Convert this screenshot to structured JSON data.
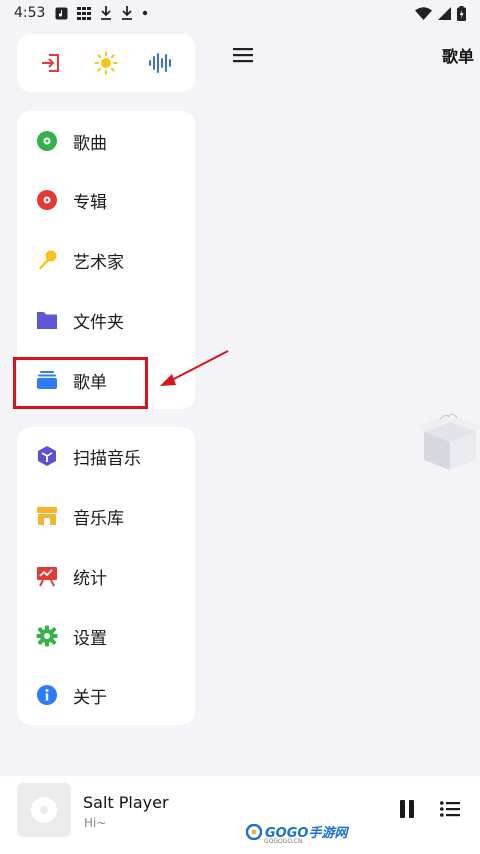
{
  "status_bar": {
    "time": "4:53"
  },
  "header": {
    "title": "歌单"
  },
  "quick_actions": [
    {
      "icon": "exit-icon",
      "color": "#e53935"
    },
    {
      "icon": "sun-icon",
      "color": "#f5c518"
    },
    {
      "icon": "equalizer-icon",
      "color": "#3b6fe0"
    }
  ],
  "nav_primary": [
    {
      "label": "歌曲",
      "icon": "song-disc-icon",
      "color": "#35b24a"
    },
    {
      "label": "专辑",
      "icon": "album-disc-icon",
      "color": "#e53935"
    },
    {
      "label": "艺术家",
      "icon": "microphone-icon",
      "color": "#f5c518"
    },
    {
      "label": "文件夹",
      "icon": "folder-icon",
      "color": "#5f57d8"
    },
    {
      "label": "歌单",
      "icon": "playlist-icon",
      "color": "#2f7cf6"
    }
  ],
  "nav_secondary": [
    {
      "label": "扫描音乐",
      "icon": "scan-icon",
      "color": "#5f4fd6"
    },
    {
      "label": "音乐库",
      "icon": "store-icon",
      "color": "#f5b52a"
    },
    {
      "label": "统计",
      "icon": "stats-icon",
      "color": "#e53935"
    },
    {
      "label": "设置",
      "icon": "gear-icon",
      "color": "#35b24a"
    },
    {
      "label": "关于",
      "icon": "info-icon",
      "color": "#2f7cf6"
    }
  ],
  "player": {
    "title": "Salt Player",
    "subtitle": "Hi~"
  },
  "watermark": {
    "text": "GOGO手游网",
    "sub": "GOGOGO.CN"
  }
}
